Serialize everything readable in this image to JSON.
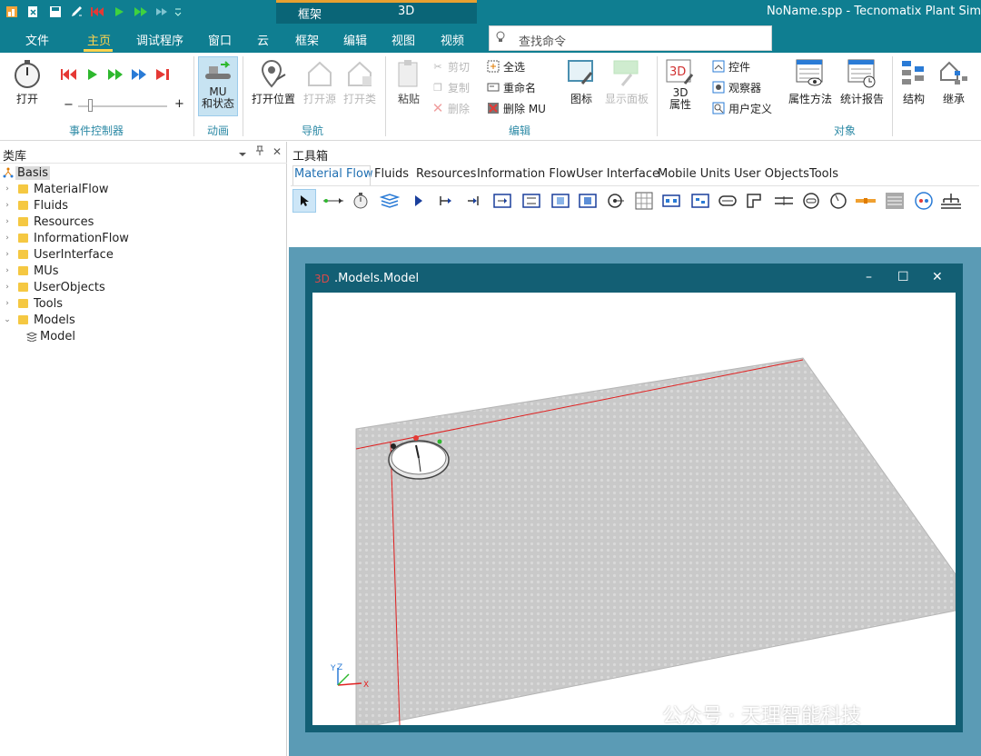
{
  "titlebar": {
    "context_group": {
      "framework_label": "框架",
      "view3d_label": "3D"
    },
    "app_title": "NoName.spp - Tecnomatix Plant Sim"
  },
  "tabs": [
    "文件",
    "主页",
    "调试程序",
    "窗口",
    "云",
    "框架",
    "编辑",
    "视图",
    "视频"
  ],
  "active_tab": "主页",
  "command_search": {
    "placeholder": "查找命令"
  },
  "ribbon": {
    "event_controller": {
      "label": "事件控制器",
      "open": "打开",
      "minus": "−",
      "plus": "+"
    },
    "animation": {
      "label": "动画",
      "mu_status": "MU\n和状态",
      "mu_line1": "MU",
      "mu_line2": "和状态"
    },
    "navigation": {
      "label": "导航",
      "open_location": "打开位置",
      "open_source": "打开源",
      "open_class": "打开类"
    },
    "edit": {
      "label": "编辑",
      "paste": "粘贴",
      "cut": "剪切",
      "copy": "复制",
      "delete": "删除",
      "select_all": "全选",
      "rename": "重命名",
      "delete_mu": "删除 MU",
      "icon": "图标",
      "show_panel": "显示面板"
    },
    "object": {
      "label": "对象",
      "attr3d_line1": "3D",
      "attr3d_line2": "属性",
      "controls": "控件",
      "observers": "观察器",
      "user_defined": "用户定义",
      "attr_methods": "属性方法",
      "stats_report": "统计报告",
      "structure": "结构",
      "inheritance": "继承"
    }
  },
  "library": {
    "title": "类库",
    "root": "Basis",
    "items": [
      "MaterialFlow",
      "Fluids",
      "Resources",
      "InformationFlow",
      "UserInterface",
      "MUs",
      "UserObjects",
      "Tools",
      "Models"
    ],
    "model_item": "Model"
  },
  "toolbox": {
    "title": "工具箱",
    "tabs": [
      "Material Flow",
      "Fluids",
      "Resources",
      "Information Flow",
      "User Interface",
      "Mobile Units",
      "User Objects",
      "Tools"
    ],
    "active_tab": "Material Flow"
  },
  "model_window": {
    "prefix": "3D",
    "title": ".Models.Model",
    "minimize": "–",
    "maximize": "☐",
    "close": "✕"
  },
  "axes": {
    "x": "X",
    "y": "Y",
    "z": "Z"
  },
  "watermark": "公众号 · 天理智能科技",
  "colors": {
    "titlebar": "#0f7e91",
    "active_tab": "#ffd34d",
    "group_label": "#2d8aa6",
    "mdi_bg": "#5b9bb5",
    "model_frame": "#135f74"
  }
}
